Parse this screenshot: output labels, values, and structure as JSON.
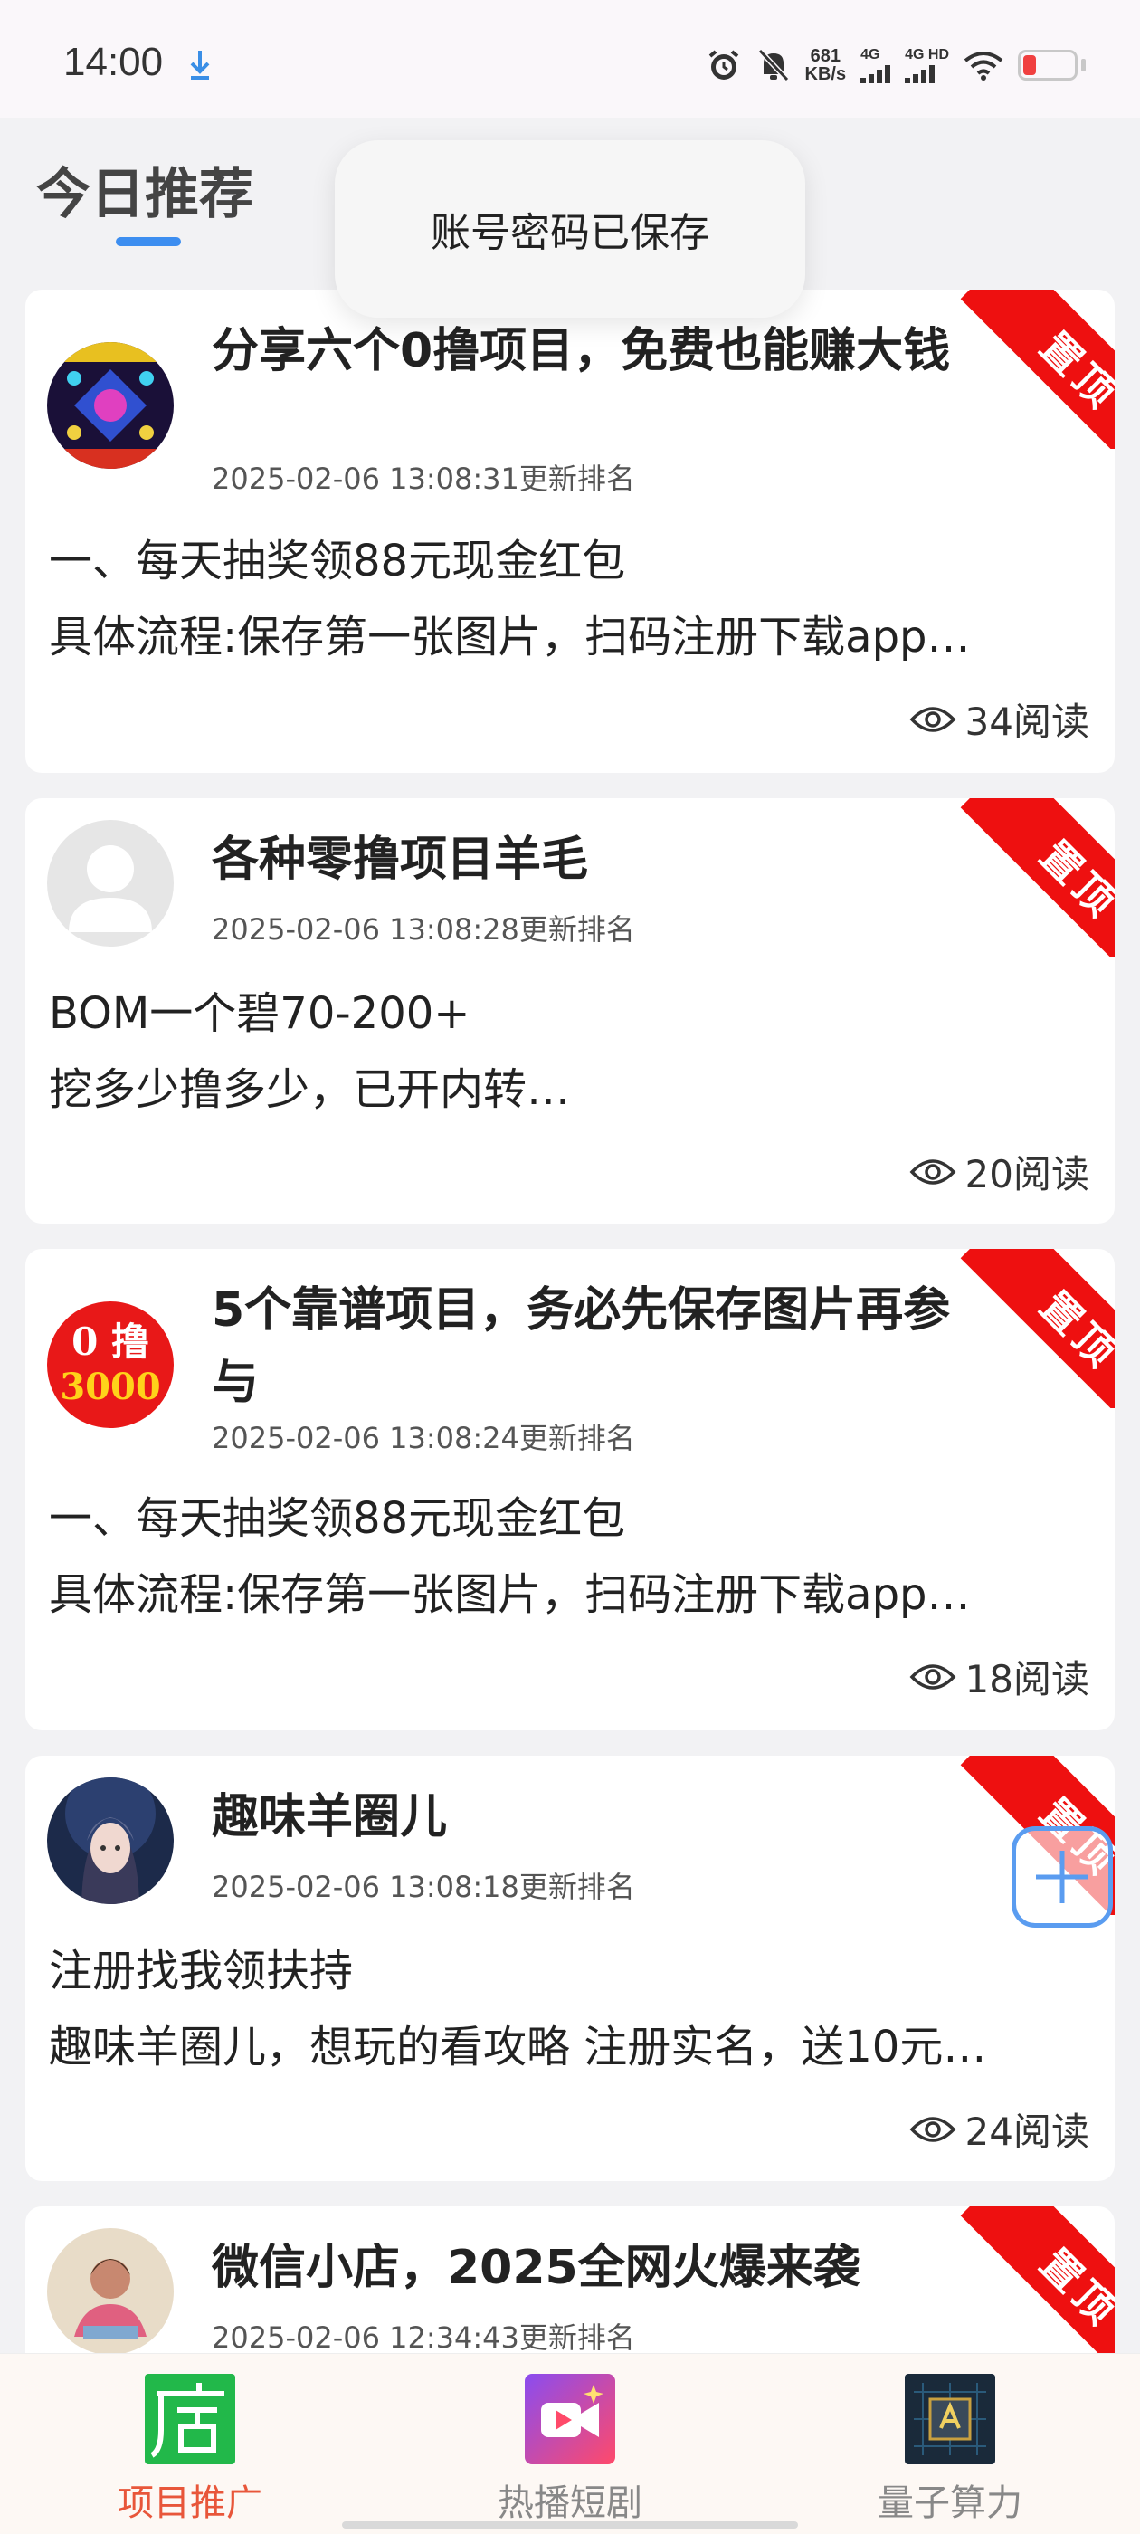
{
  "status_bar": {
    "time": "14:00",
    "speed_value": "681",
    "speed_unit": "KB/s",
    "net1": "4G",
    "net2": "4G HD"
  },
  "header": {
    "tab_title": "今日推荐"
  },
  "toast": {
    "message": "账号密码已保存"
  },
  "pin_label": "置顶",
  "posts": [
    {
      "title": "分享六个0撸项目，免费也能赚大钱",
      "date": "2025-02-06 13:08:31更新排名",
      "line1": "一、每天抽奖领88元现金红包",
      "line2": "具体流程:保存第一张图片，扫码注册下载app…",
      "views": "34阅读"
    },
    {
      "title": "各种零撸项目羊毛",
      "date": "2025-02-06 13:08:28更新排名",
      "line1": "BOM一个碧70-200+",
      "line2": "挖多少撸多少，已开内转…",
      "views": "20阅读"
    },
    {
      "title": "5个靠谱项目，务必先保存图片再参与",
      "avatar_text_top": "0 撸",
      "avatar_text_bottom": "3000",
      "date": "2025-02-06 13:08:24更新排名",
      "line1": "一、每天抽奖领88元现金红包",
      "line2": "具体流程:保存第一张图片，扫码注册下载app…",
      "views": "18阅读"
    },
    {
      "title": "趣味羊圈儿",
      "date": "2025-02-06 13:08:18更新排名",
      "line1": "注册找我领扶持",
      "line2": "趣味羊圈儿，想玩的看攻略 注册实名，送10元…",
      "views": "24阅读"
    },
    {
      "title": "微信小店，2025全网火爆来袭",
      "date": "2025-02-06 12:34:43更新排名"
    }
  ],
  "bottom_nav": [
    {
      "label": "项目推广",
      "active": true
    },
    {
      "label": "热播短剧",
      "active": false
    },
    {
      "label": "量子算力",
      "active": false
    }
  ],
  "colors": {
    "accent": "#3d8ef0",
    "pin_red": "#ee1010",
    "nav_active": "#e8563a"
  }
}
